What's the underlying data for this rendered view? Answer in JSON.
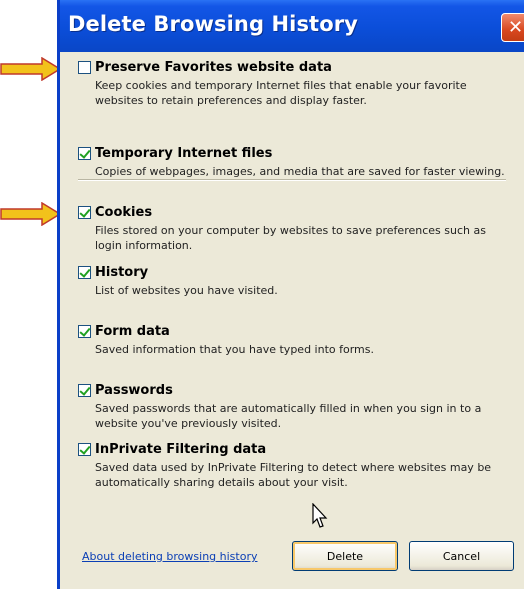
{
  "dialog": {
    "title": "Delete Browsing History",
    "close_symbol": "✕"
  },
  "options": [
    {
      "label": "Preserve Favorites website data",
      "checked": false,
      "description": "Keep cookies and temporary Internet files that enable your favorite websites to retain preferences and display faster."
    },
    {
      "label": "Temporary Internet files",
      "checked": true,
      "description": "Copies of webpages, images, and media that are saved for faster viewing."
    },
    {
      "label": "Cookies",
      "checked": true,
      "description": "Files stored on your computer by websites to save preferences such as login information."
    },
    {
      "label": "History",
      "checked": true,
      "description": "List of websites you have visited."
    },
    {
      "label": "Form data",
      "checked": true,
      "description": "Saved information that you have typed into forms."
    },
    {
      "label": "Passwords",
      "checked": true,
      "description": "Saved passwords that are automatically filled in when you sign in to a website you've previously visited."
    },
    {
      "label": "InPrivate Filtering data",
      "checked": true,
      "description": "Saved data used by InPrivate Filtering to detect where websites may be automatically sharing details about your visit."
    }
  ],
  "footer": {
    "help_link": "About deleting browsing history",
    "delete_label": "Delete",
    "cancel_label": "Cancel"
  },
  "annotations": {
    "arrow_color": "#f2c21b",
    "arrow_outline": "#c0392b",
    "arrow_targets": [
      "Preserve Favorites website data",
      "Cookies"
    ]
  }
}
